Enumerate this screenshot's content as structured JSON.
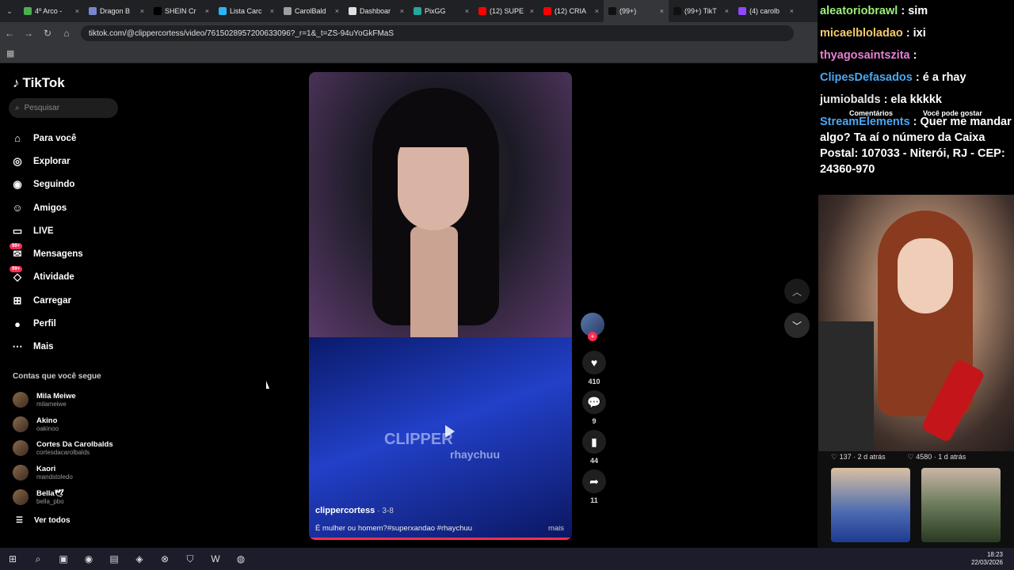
{
  "browser": {
    "tabs": [
      {
        "label": "4º Arco -",
        "color": "#4caf50"
      },
      {
        "label": "Dragon B",
        "color": "#7986cb"
      },
      {
        "label": "SHEIN Cr",
        "color": "#000000"
      },
      {
        "label": "Lista Carc",
        "color": "#29b6f6"
      },
      {
        "label": "CarolBald",
        "color": "#9e9e9e"
      },
      {
        "label": "Dashboar",
        "color": "#e0e0e0"
      },
      {
        "label": "PixGG",
        "color": "#26a69a"
      },
      {
        "label": "(12) SUPE",
        "color": "#ff0000"
      },
      {
        "label": "(12) CRIA",
        "color": "#ff0000"
      },
      {
        "label": "(99+)",
        "color": "#111111"
      },
      {
        "label": "(99+) TikT",
        "color": "#111111"
      },
      {
        "label": "(4) carolb",
        "color": "#9146ff"
      }
    ],
    "active_tab_index": 9,
    "url": "tiktok.com/@clippercortess/video/7615028957200633096?_r=1&_t=ZS-94uYoGkFMaS"
  },
  "tiktok": {
    "logo": "TikTok",
    "search_placeholder": "Pesquisar",
    "nav": [
      {
        "label": "Para você",
        "icon": "home-icon",
        "glyph": "⌂"
      },
      {
        "label": "Explorar",
        "icon": "compass-icon",
        "glyph": "◎"
      },
      {
        "label": "Seguindo",
        "icon": "following-icon",
        "glyph": "◉"
      },
      {
        "label": "Amigos",
        "icon": "friends-icon",
        "glyph": "☺"
      },
      {
        "label": "LIVE",
        "icon": "live-icon",
        "glyph": "▭"
      },
      {
        "label": "Mensagens",
        "icon": "messages-icon",
        "glyph": "✉",
        "badge": "99+"
      },
      {
        "label": "Atividade",
        "icon": "activity-icon",
        "glyph": "◇",
        "badge": "99+"
      },
      {
        "label": "Carregar",
        "icon": "upload-icon",
        "glyph": "⊞"
      },
      {
        "label": "Perfil",
        "icon": "profile-icon",
        "glyph": "●"
      },
      {
        "label": "Mais",
        "icon": "more-icon",
        "glyph": "⋯"
      }
    ],
    "following_title": "Contas que você segue",
    "following": [
      {
        "name": "Mila Meiwe",
        "user": "milameiwe"
      },
      {
        "name": "Akino",
        "user": "oakinoo"
      },
      {
        "name": "Cortes Da Carolbalds",
        "user": "cortesdacarolbalds"
      },
      {
        "name": "Kaori",
        "user": "mandstoledo"
      },
      {
        "name": "Bella🕊",
        "user": "bella_pbo"
      }
    ],
    "see_all": "Ver todos",
    "video": {
      "watermark": "CLIPPER",
      "watermark_sub": "rhaychuu",
      "author": "clippercortess",
      "date": "· 3-8",
      "description": "É mulher ou homem?#superxandao #rhaychuu",
      "more": "mais",
      "progress": 1.0
    },
    "actions": {
      "likes": "410",
      "comments": "9",
      "saves": "44",
      "shares": "11"
    }
  },
  "stream_overlay": {
    "chat": [
      {
        "user": "aleatoriobrawl",
        "message": ": sim"
      },
      {
        "user": "micaelbloladao",
        "message": ": ixi"
      },
      {
        "user": "thyagosaintszita",
        "message": ":"
      },
      {
        "user": "ClipesDefasados",
        "message": ": é a rhay"
      },
      {
        "user": "jumiobalds",
        "message": ": ela kkkkk"
      },
      {
        "user": "StreamElements",
        "message": ": Quer me mandar algo? Ta aí o número da Caixa Postal: 107033 - Niterói, RJ - CEP: 24360-970"
      }
    ],
    "labels": {
      "comments": "Comentários",
      "suggested": "Você pode gostar"
    },
    "thumb_stats": [
      {
        "likes": "137",
        "age": "2 d atrás"
      },
      {
        "likes": "4580",
        "age": "1 d atrás"
      }
    ]
  },
  "taskbar": {
    "time": "18:23",
    "date": "22/03/2026"
  }
}
